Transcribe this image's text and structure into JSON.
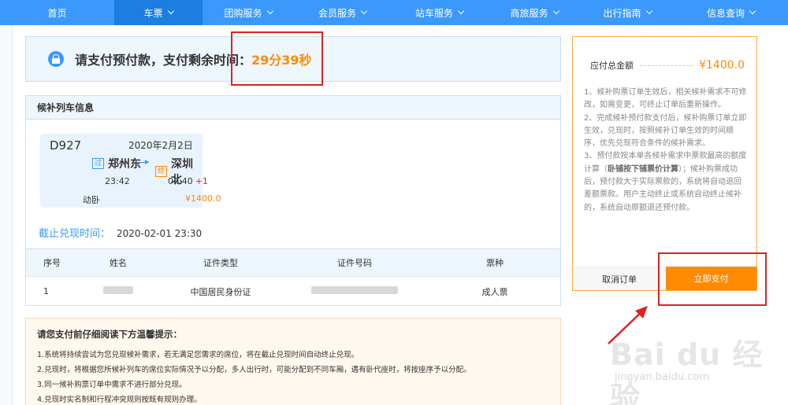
{
  "nav": {
    "items": [
      {
        "label": "首页",
        "dropdown": false,
        "active": false
      },
      {
        "label": "车票",
        "dropdown": true,
        "active": true
      },
      {
        "label": "团购服务",
        "dropdown": true,
        "active": false
      },
      {
        "label": "会员服务",
        "dropdown": true,
        "active": false
      },
      {
        "label": "站车服务",
        "dropdown": true,
        "active": false
      },
      {
        "label": "商旅服务",
        "dropdown": true,
        "active": false
      },
      {
        "label": "出行指南",
        "dropdown": true,
        "active": false
      },
      {
        "label": "信息查询",
        "dropdown": true,
        "active": false
      }
    ]
  },
  "payment": {
    "title": "请支付预付款，支付剩余时间：",
    "remaining": "29分39秒"
  },
  "train": {
    "panel_title": "候补列车信息",
    "number": "D927",
    "date": "2020年2月2日",
    "from_badge": "过",
    "from": "郑州东",
    "to_badge": "终",
    "to": "深圳北",
    "depart_time": "23:42",
    "arrive_time": "07:40",
    "day_offset": "+1",
    "seat_type": "动卧",
    "price": "¥1400.0",
    "deadline_label": "截止兑现时间：",
    "deadline_value": "2020-02-01 23:30"
  },
  "passengers": {
    "headers": [
      "序号",
      "姓名",
      "证件类型",
      "证件号码",
      "票种"
    ],
    "rows": [
      {
        "index": "1",
        "id_type": "中国居民身份证",
        "ticket_type": "成人票"
      }
    ]
  },
  "notice": {
    "title": "请您支付前仔细阅读下方温馨提示：",
    "lines": [
      "1.系统将持续尝试为您兑现候补需求，若无满足您需求的席位，将在截止兑现时间自动终止兑现。",
      "2.兑现时，将根据您所候补列车的席位实际情况予以分配，多人出行时，可能分配到不同车厢，遇有卧代座时，将按座序予以分配。",
      "3.同一候补购票订单中需求不进行部分兑现。",
      "4.兑现时实名制和行程冲突规则按既有规则办理。"
    ]
  },
  "summary": {
    "total_label": "应付总金额",
    "total_amount": "¥1400.0",
    "rule1": "1、候补购票订单生效后，相关候补需求不可修改，如需变更，可终止订单后重新操作。",
    "rule2": "2、完成候补预付款支付后，候补购票订单立即生效，兑现时，按照候补订单生效的时间顺序，优先兑现符合条件的候补需求。",
    "rule3_a": "3、预付款按本单各候补需求中票款最高的额度计算（",
    "rule3_b": "卧铺按下铺票价计算",
    "rule3_c": "）；候补购票成功后，预付款大于实际票款的，系统将自动退回差额票款。用户主动终止或系统自动终止候补的，系统自动原额退还预付款。",
    "cancel_label": "取消订单",
    "pay_label": "立即支付"
  },
  "watermark": {
    "main": "Bai du 经验",
    "sub": "jingyan.baidu.com"
  },
  "colors": {
    "nav": "#3b99fc",
    "accent": "#ff8a00",
    "annotation": "#e02020"
  }
}
